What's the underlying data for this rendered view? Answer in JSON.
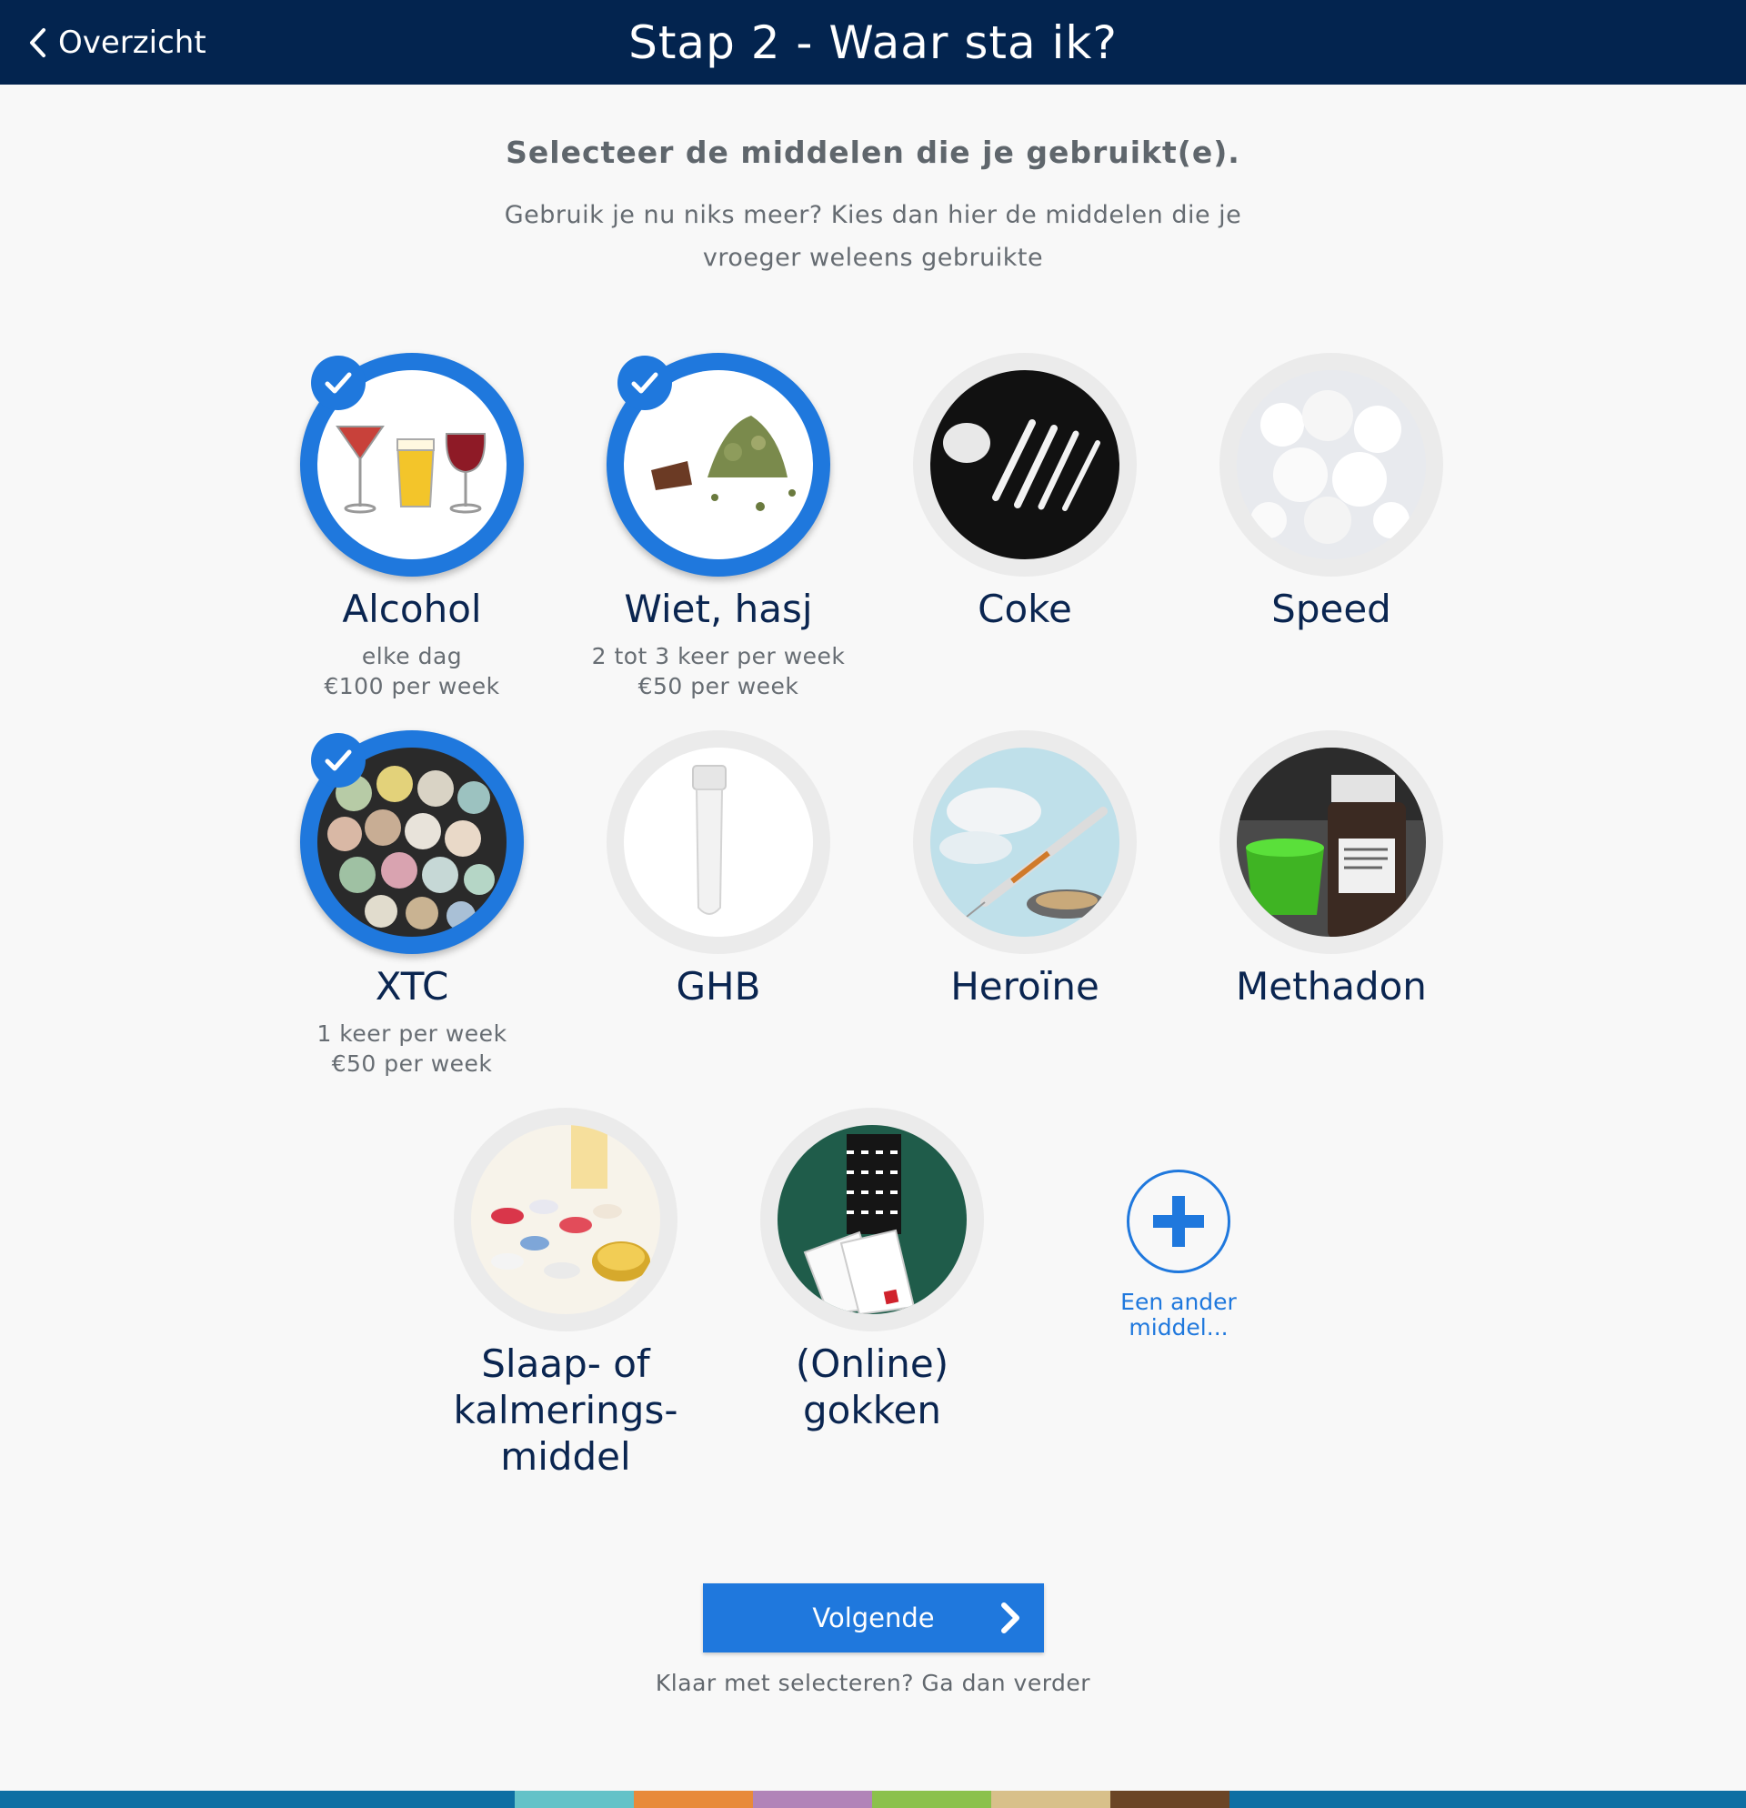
{
  "header": {
    "back_label": "Overzicht",
    "title": "Stap 2 - Waar sta ik?"
  },
  "intro": {
    "title": "Selecteer de middelen die je gebruikt(e).",
    "subtitle": "Gebruik je nu niks meer? Kies dan hier de middelen die je vroeger weleens gebruikte"
  },
  "substances": [
    {
      "label": "Alcohol",
      "selected": true,
      "details": [
        "elke dag",
        "€100 per week"
      ],
      "icon": "alcohol-glasses"
    },
    {
      "label": "Wiet, hasj",
      "selected": true,
      "details": [
        "2 tot 3 keer per week",
        "€50 per week"
      ],
      "icon": "cannabis"
    },
    {
      "label": "Coke",
      "selected": false,
      "details": [],
      "icon": "cocaine-lines"
    },
    {
      "label": "Speed",
      "selected": false,
      "details": [],
      "icon": "speed-powder"
    },
    {
      "label": "XTC",
      "selected": true,
      "details": [
        "1 keer per week",
        "€50 per week"
      ],
      "icon": "xtc-pills"
    },
    {
      "label": "GHB",
      "selected": false,
      "details": [],
      "icon": "ghb-vial"
    },
    {
      "label": "Heroïne",
      "selected": false,
      "details": [],
      "icon": "heroin-syringe"
    },
    {
      "label": "Methadon",
      "selected": false,
      "details": [],
      "icon": "methadone-bottle"
    },
    {
      "label": "Slaap- of kalmerings-middel",
      "lines": [
        "Slaap- of",
        "kalmerings-",
        "middel"
      ],
      "selected": false,
      "details": [],
      "icon": "pills"
    },
    {
      "label": "(Online) gokken",
      "lines": [
        "(Online)",
        "gokken"
      ],
      "selected": false,
      "details": [],
      "icon": "poker-chips"
    }
  ],
  "add_other": {
    "lines": [
      "Een ander",
      "middel..."
    ],
    "icon": "plus-icon"
  },
  "footer": {
    "next_label": "Volgende",
    "hint": "Klaar met selecteren? Ga dan verder"
  },
  "colors": {
    "header_bg": "#03244f",
    "accent": "#1f78dd",
    "strip": [
      "#0e6fa3",
      "#64c2c8",
      "#e88a3a",
      "#b184b8",
      "#8bc14c",
      "#d8c08a",
      "#6b4526",
      "#0e6fa3"
    ]
  }
}
